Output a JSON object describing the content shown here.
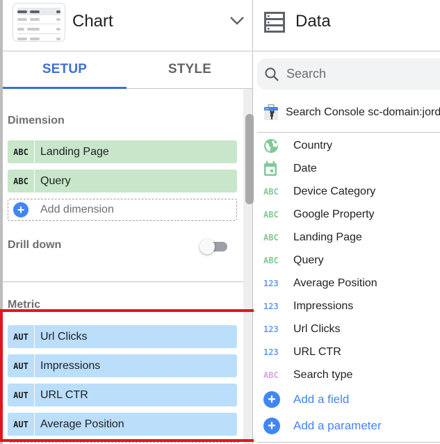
{
  "left_panel": {
    "title": "Chart",
    "tabs": [
      {
        "label": "SETUP",
        "active": true
      },
      {
        "label": "STYLE",
        "active": false
      }
    ],
    "dimension": {
      "label": "Dimension",
      "items": [
        {
          "type": "ABC",
          "label": "Landing Page"
        },
        {
          "type": "ABC",
          "label": "Query"
        }
      ],
      "add_label": "Add dimension"
    },
    "drill_down": {
      "label": "Drill down",
      "enabled": false
    },
    "metric": {
      "label": "Metric",
      "items": [
        {
          "type": "AUT",
          "label": "Url Clicks"
        },
        {
          "type": "AUT",
          "label": "Impressions"
        },
        {
          "type": "AUT",
          "label": "URL CTR"
        },
        {
          "type": "AUT",
          "label": "Average Position"
        }
      ]
    }
  },
  "right_panel": {
    "title": "Data",
    "search": {
      "placeholder": "Search",
      "value": ""
    },
    "source": "Search Console sc-domain:jord",
    "fields": [
      {
        "icon": "globe-icon",
        "kind": "dim",
        "label": "Country"
      },
      {
        "icon": "calendar-icon",
        "kind": "dim",
        "label": "Date"
      },
      {
        "icon": "ABC",
        "kind": "dim",
        "label": "Device Category"
      },
      {
        "icon": "ABC",
        "kind": "dim",
        "label": "Google Property"
      },
      {
        "icon": "ABC",
        "kind": "dim",
        "label": "Landing Page"
      },
      {
        "icon": "ABC",
        "kind": "dim",
        "label": "Query"
      },
      {
        "icon": "123",
        "kind": "met",
        "label": "Average Position"
      },
      {
        "icon": "123",
        "kind": "met",
        "label": "Impressions"
      },
      {
        "icon": "123",
        "kind": "met",
        "label": "Url Clicks"
      },
      {
        "icon": "123",
        "kind": "met",
        "label": "URL CTR"
      },
      {
        "icon": "ABC",
        "kind": "purple",
        "label": "Search type"
      }
    ],
    "add_field": "Add a field",
    "add_parameter": "Add a parameter"
  },
  "colors": {
    "accent_blue": "#3c6fd6",
    "dimension_chip": "#c8e6c9",
    "metric_chip": "#bbdefb",
    "highlight_red": "#e0161f",
    "link_blue": "#4285f4"
  }
}
